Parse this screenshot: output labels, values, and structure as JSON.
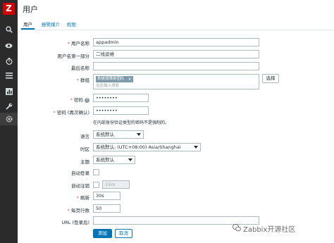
{
  "app": {
    "logo": "Z"
  },
  "sidebar": {
    "icons": [
      "search-icon",
      "eye-icon",
      "clock-icon",
      "list-icon",
      "chart-icon",
      "wrench-icon",
      "gear-icon"
    ]
  },
  "page": {
    "title": "用户"
  },
  "tabs": [
    {
      "label": "用户",
      "active": true
    },
    {
      "label": "报警媒介",
      "active": false
    },
    {
      "label": "权限",
      "active": false
    }
  ],
  "form": {
    "alias": {
      "label": "用户名称",
      "value": "appadmin"
    },
    "name": {
      "label": "用户名第一部分",
      "value": "二线运维"
    },
    "surname": {
      "label": "最后名称",
      "value": ""
    },
    "groups": {
      "label": "群组",
      "chip": "系统保障部团队",
      "placeholder": "在此输入搜索",
      "select_label": "选择"
    },
    "password": {
      "label": "密码",
      "value": "••••••••"
    },
    "password2": {
      "label": "密码 (再次确认)",
      "value": "••••••••"
    },
    "password_hint": "在内部身份验证类型的密码不是强制的。",
    "lang": {
      "label": "语言",
      "value": "系统默认"
    },
    "timezone": {
      "label": "时区",
      "value": "系统默认: (UTC+08:00) Asia/Shanghai"
    },
    "theme": {
      "label": "主题",
      "value": "系统默认"
    },
    "autologin": {
      "label": "自动登录",
      "checked": false
    },
    "autologout": {
      "label": "自动注销",
      "checked": false,
      "value": "15m"
    },
    "refresh": {
      "label": "刷新",
      "value": "30s"
    },
    "rows_per_page": {
      "label": "每页行数",
      "value": "50"
    },
    "url": {
      "label": "URL (登录后)",
      "value": ""
    }
  },
  "actions": {
    "add_label": "添加",
    "cancel_label": "取消"
  },
  "watermark": "Zabbix开源社区",
  "colors": {
    "sidebar": "#2b2b2b",
    "logo": "#d40000",
    "accent": "#0275b8",
    "required": "#e45959"
  }
}
